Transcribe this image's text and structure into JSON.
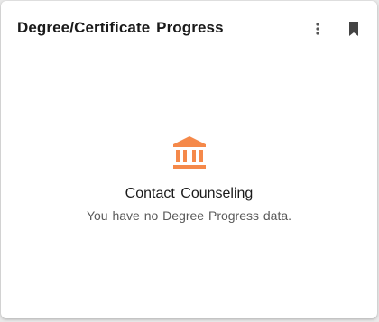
{
  "card": {
    "title": "Degree/Certificate Progress",
    "actions": {
      "more_icon": "more-vertical-icon",
      "bookmark_icon": "bookmark-icon"
    },
    "empty_state": {
      "icon": "institution-icon",
      "icon_color": "#f5894a",
      "heading": "Contact Counseling",
      "message": "You have no Degree Progress data."
    }
  }
}
